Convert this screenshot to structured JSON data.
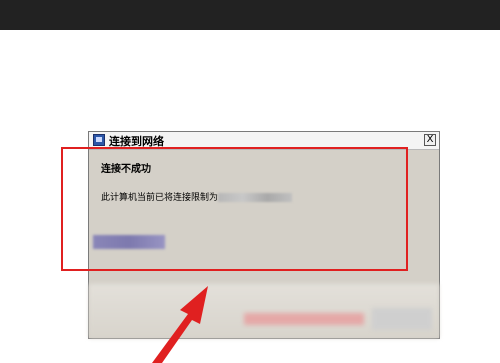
{
  "dialog": {
    "title": "连接到网络",
    "close_label": "X",
    "heading": "连接不成功",
    "message": "此计算机当前已将连接限制为"
  },
  "annotation": {
    "highlight_color": "#e02020",
    "arrow_color": "#e02020"
  }
}
